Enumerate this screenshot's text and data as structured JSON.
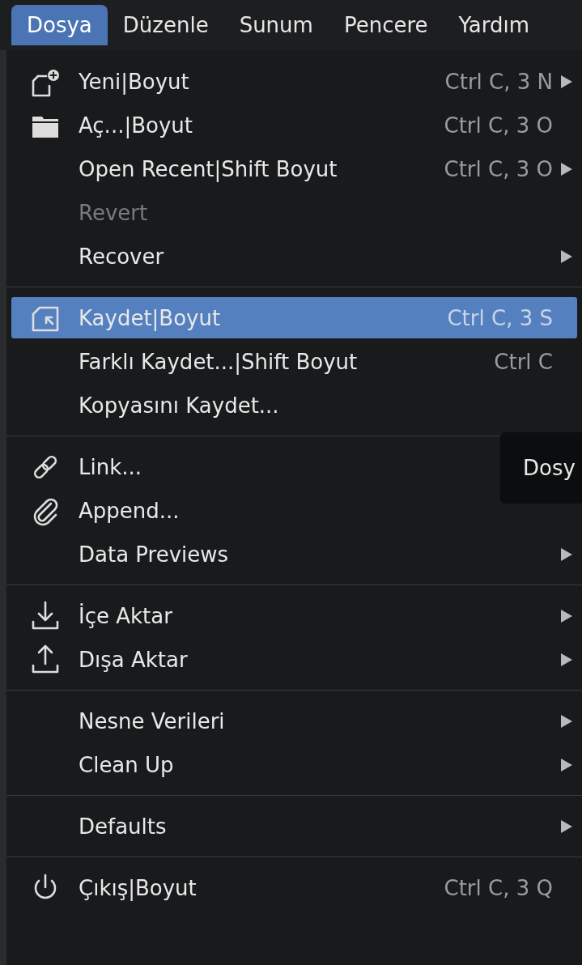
{
  "menubar": [
    {
      "label": "Dosya",
      "selected": true
    },
    {
      "label": "Düzenle",
      "selected": false
    },
    {
      "label": "Sunum",
      "selected": false
    },
    {
      "label": "Pencere",
      "selected": false
    },
    {
      "label": "Yardım",
      "selected": false
    }
  ],
  "menu": {
    "sections": [
      {
        "items": [
          {
            "kind": "new",
            "label": "Yeni|Boyut",
            "shortcut": "Ctrl C, 3 N",
            "submenu": true,
            "disabled": false,
            "highlighted": false
          },
          {
            "kind": "open",
            "label": "Aç...|Boyut",
            "shortcut": "Ctrl C, 3 O",
            "submenu": false,
            "disabled": false,
            "highlighted": false
          },
          {
            "kind": "plain",
            "label": "Open Recent|Shift Boyut",
            "shortcut": "Ctrl C, 3 O",
            "submenu": true,
            "disabled": false,
            "highlighted": false
          },
          {
            "kind": "plain",
            "label": "Revert",
            "submenu": false,
            "disabled": true,
            "highlighted": false
          },
          {
            "kind": "plain",
            "label": "Recover",
            "submenu": true,
            "disabled": false,
            "highlighted": false
          }
        ]
      },
      {
        "items": [
          {
            "kind": "save",
            "label": "Kaydet|Boyut",
            "shortcut": "Ctrl C, 3 S",
            "submenu": false,
            "disabled": false,
            "highlighted": true
          },
          {
            "kind": "plain",
            "label": "Farklı Kaydet...|Shift Boyut",
            "shortcut": "Ctrl C",
            "submenu": false,
            "disabled": false,
            "highlighted": false
          },
          {
            "kind": "plain",
            "label": "Kopyasını Kaydet...",
            "submenu": false,
            "disabled": false,
            "highlighted": false
          }
        ]
      },
      {
        "items": [
          {
            "kind": "link",
            "label": "Link...",
            "submenu": false,
            "disabled": false,
            "highlighted": false
          },
          {
            "kind": "append",
            "label": "Append...",
            "submenu": false,
            "disabled": false,
            "highlighted": false
          },
          {
            "kind": "plain",
            "label": "Data Previews",
            "submenu": true,
            "disabled": false,
            "highlighted": false
          }
        ]
      },
      {
        "items": [
          {
            "kind": "import",
            "label": "İçe Aktar",
            "submenu": true,
            "disabled": false,
            "highlighted": false
          },
          {
            "kind": "export",
            "label": "Dışa Aktar",
            "submenu": true,
            "disabled": false,
            "highlighted": false
          }
        ]
      },
      {
        "items": [
          {
            "kind": "plain",
            "label": "Nesne Verileri",
            "submenu": true,
            "disabled": false,
            "highlighted": false
          },
          {
            "kind": "plain",
            "label": "Clean Up",
            "submenu": true,
            "disabled": false,
            "highlighted": false
          }
        ]
      },
      {
        "items": [
          {
            "kind": "plain",
            "label": "Defaults",
            "submenu": true,
            "disabled": false,
            "highlighted": false
          }
        ]
      },
      {
        "items": [
          {
            "kind": "quit",
            "label": "Çıkış|Boyut",
            "shortcut": "Ctrl C, 3 Q",
            "submenu": false,
            "disabled": false,
            "highlighted": false
          }
        ]
      }
    ]
  },
  "tooltip": {
    "text": "Dosy"
  }
}
